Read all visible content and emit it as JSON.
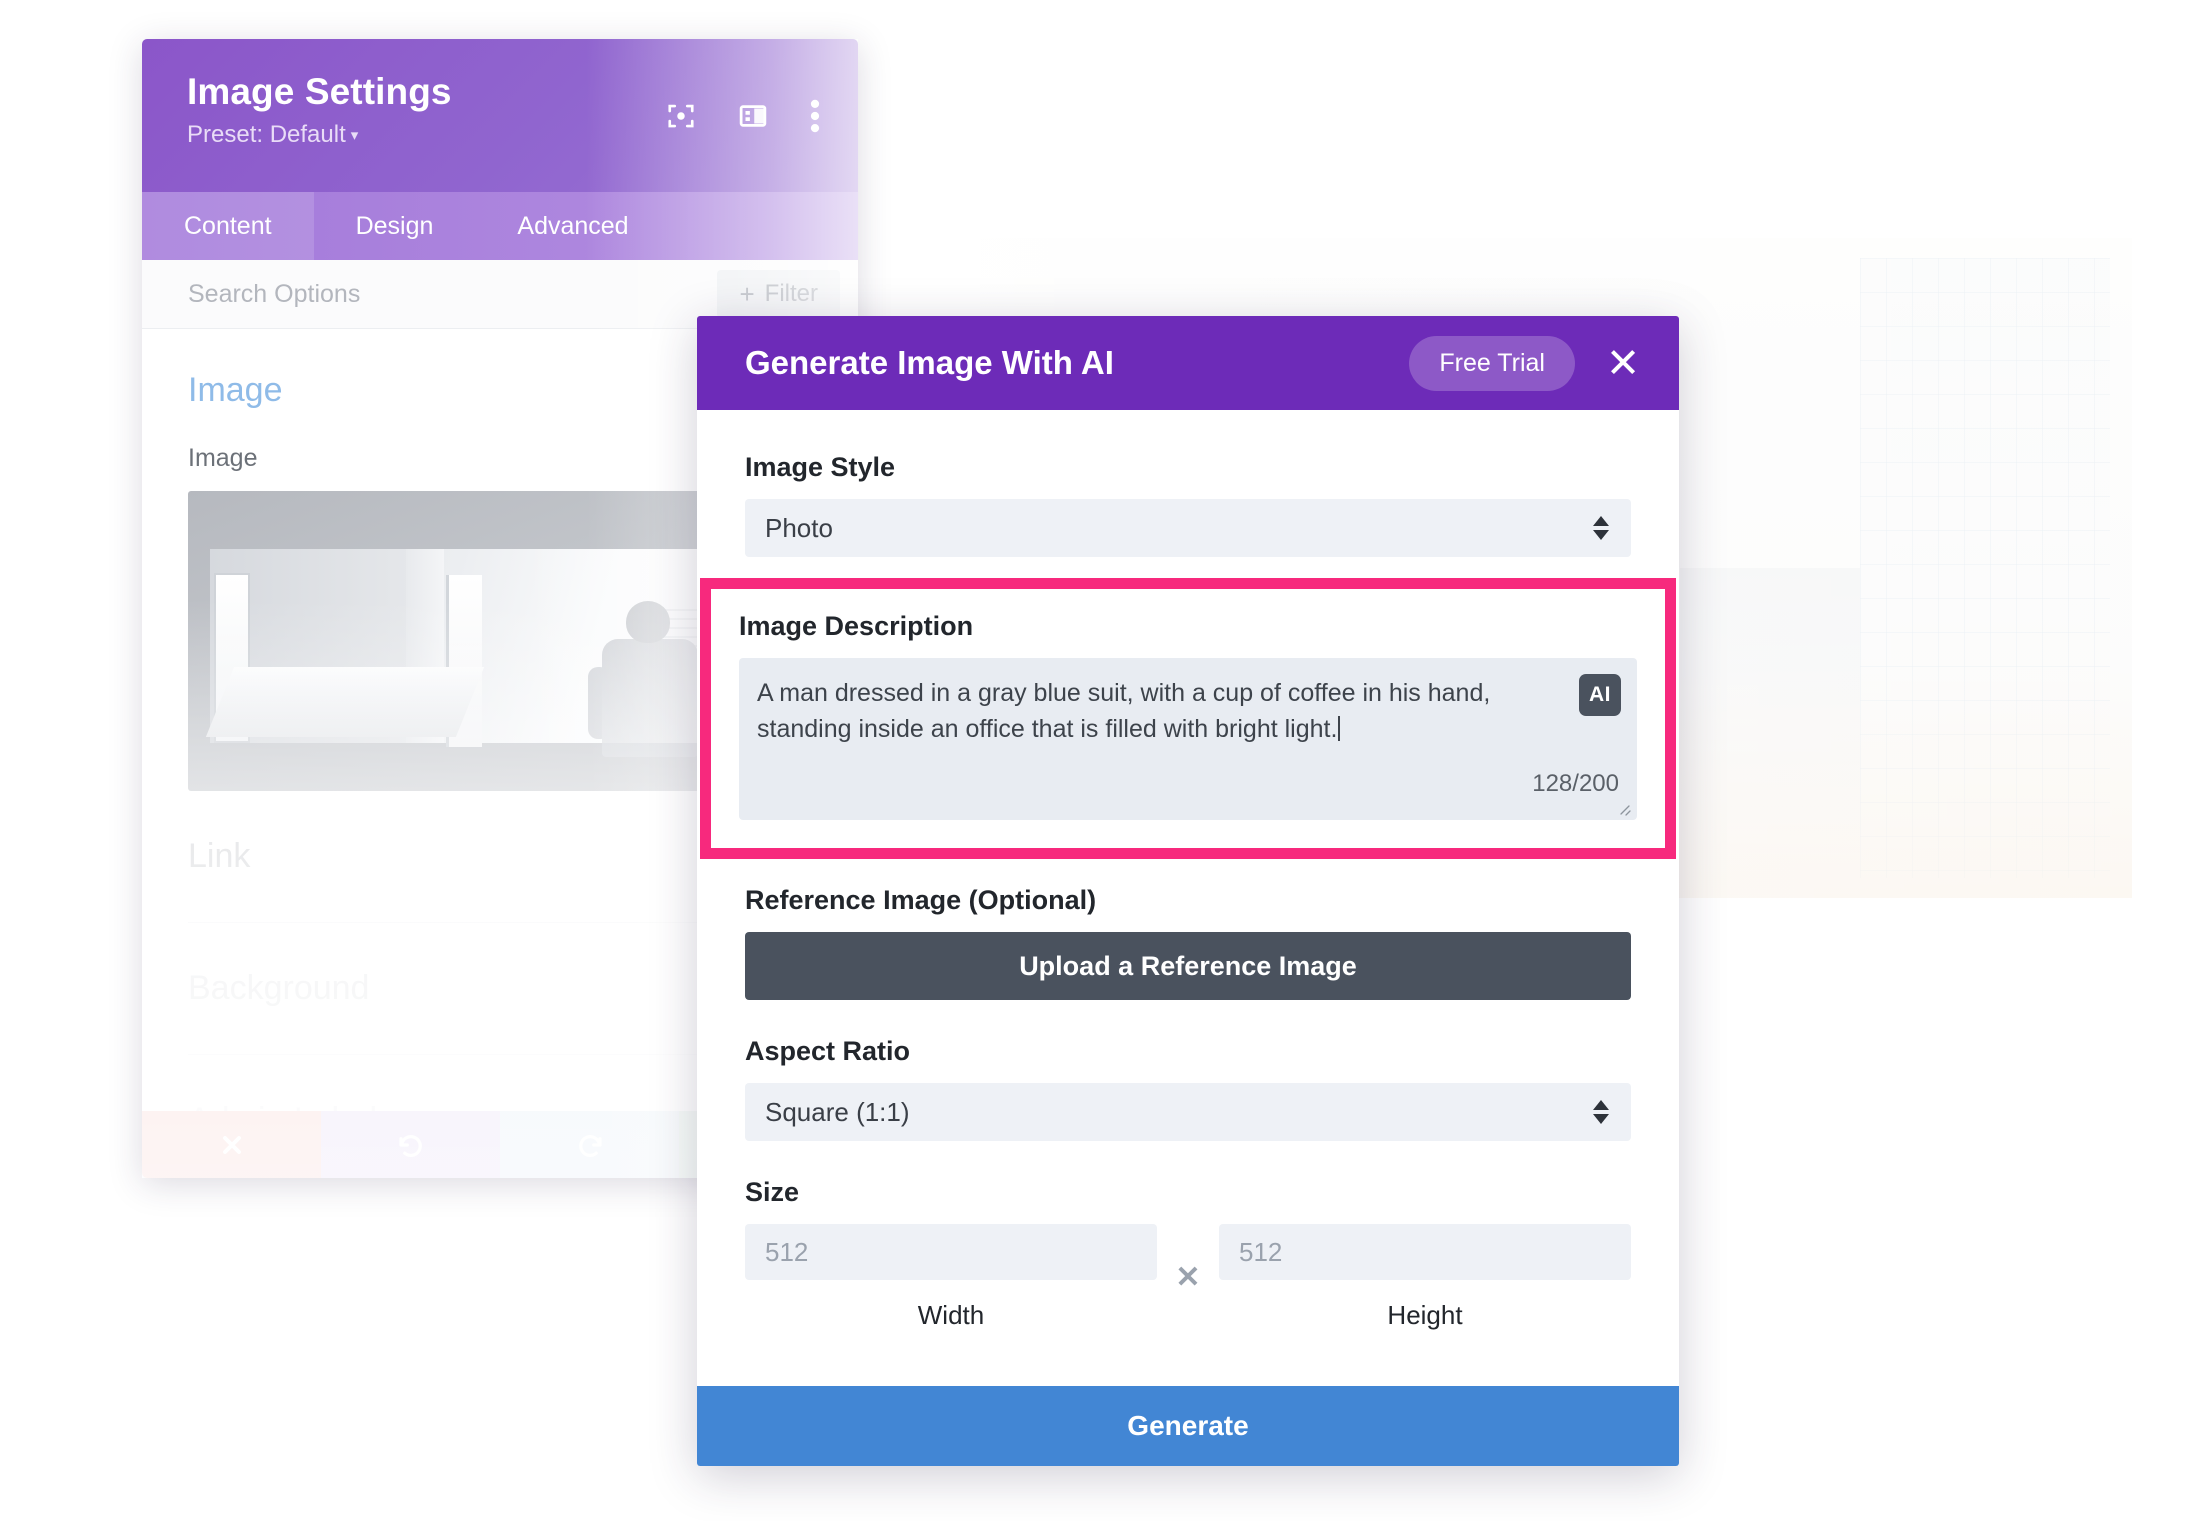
{
  "settings_panel": {
    "title": "Image Settings",
    "preset_label": "Preset: Default",
    "preset_caret": "▾",
    "header_icons": [
      {
        "name": "focus-target-icon"
      },
      {
        "name": "layout-panel-icon"
      },
      {
        "name": "more-vertical-icon"
      }
    ],
    "tabs": [
      {
        "label": "Content",
        "active": true
      },
      {
        "label": "Design",
        "active": false
      },
      {
        "label": "Advanced",
        "active": false
      }
    ],
    "search": {
      "placeholder": "Search Options",
      "filter_label": "Filter",
      "filter_plus": "+"
    },
    "section_title": "Image",
    "image_field_label": "Image",
    "ghost_sections": [
      {
        "label": "Link"
      },
      {
        "label": "Background"
      },
      {
        "label": "Admin Label"
      }
    ],
    "footer_buttons": [
      {
        "name": "cancel-button",
        "icon": "close-icon"
      },
      {
        "name": "undo-button",
        "icon": "undo-icon"
      },
      {
        "name": "redo-button",
        "icon": "redo-icon"
      },
      {
        "name": "save-button",
        "icon": "check-icon"
      }
    ]
  },
  "ai_dialog": {
    "title": "Generate Image With AI",
    "trial_badge": "Free Trial",
    "close_label": "✕",
    "image_style": {
      "label": "Image Style",
      "value": "Photo"
    },
    "image_description": {
      "label": "Image Description",
      "value": "A man dressed in a gray blue suit, with a cup of coffee in his hand, standing inside an office that is filled with bright light.",
      "badge": "AI",
      "counter": "128/200"
    },
    "reference_image": {
      "label": "Reference Image (Optional)",
      "button_label": "Upload a Reference Image"
    },
    "aspect_ratio": {
      "label": "Aspect Ratio",
      "value": "Square (1:1)"
    },
    "size": {
      "label": "Size",
      "width_placeholder": "512",
      "height_placeholder": "512",
      "separator": "✕",
      "width_caption": "Width",
      "height_caption": "Height"
    },
    "generate_label": "Generate"
  },
  "colors": {
    "panel_purple": "#8b56c9",
    "tabs_purple": "#a379da",
    "dialog_purple": "#6d2bb8",
    "highlight_pink": "#f7297d",
    "generate_blue": "#4286d4",
    "upload_slate": "#4a525e",
    "section_blue": "#8fbbe8"
  }
}
